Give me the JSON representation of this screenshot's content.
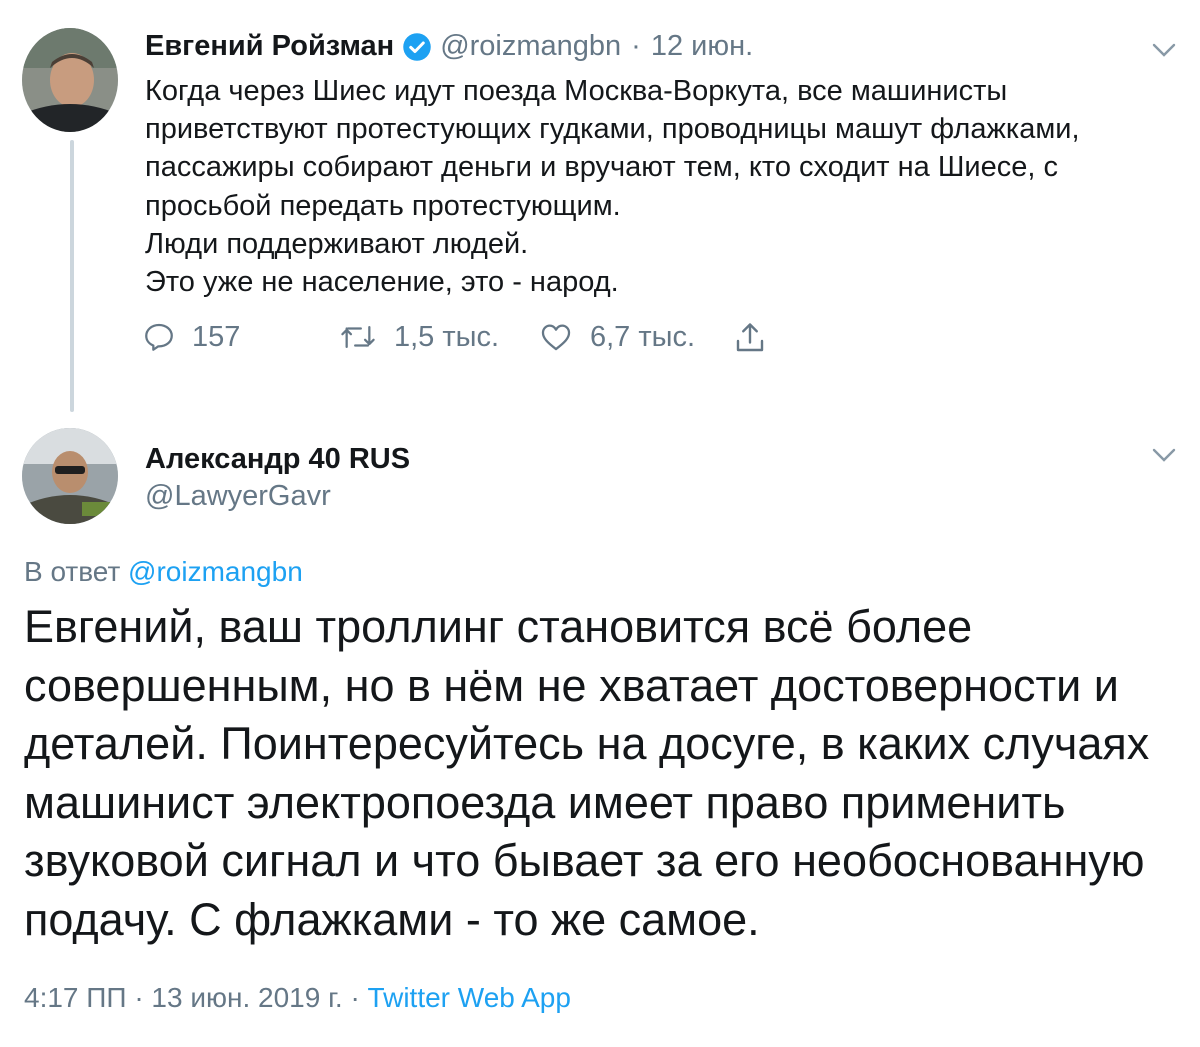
{
  "tweet1": {
    "author_name": "Евгений Ройзман",
    "handle": "@roizmangbn",
    "separator": "·",
    "date": "12 июн.",
    "lines": [
      "Когда через Шиес идут поезда Москва-Воркута, все машинисты",
      "приветствуют протестующих гудками, проводницы машут флажками,",
      "пассажиры собирают деньги и вручают тем, кто сходит на Шиесе, с",
      "просьбой передать протестующим.",
      "Люди поддерживают людей.",
      "Это уже не население, это - народ."
    ],
    "reply_count": "157",
    "retweet_count": "1,5 тыс.",
    "like_count": "6,7 тыс."
  },
  "tweet2": {
    "author_name": "Александр 40 RUS",
    "handle": "@LawyerGavr",
    "reply_prefix": "В ответ",
    "reply_handle": "@roizmangbn",
    "lines": [
      "Евгений, ваш троллинг становится всё более",
      "совершенным, но в нём не хватает достоверности и",
      "деталей. Поинтересуйтесь на досуге, в каких случаях",
      "машинист электропоезда имеет право применить",
      "звуковой сигнал и что бывает за его необоснованную",
      "подачу. С флажками - то же самое."
    ],
    "time": "4:17 ПП",
    "separator": "·",
    "date": "13 июн. 2019 г.",
    "source": "Twitter Web App"
  },
  "icons": {
    "verified": "verified-badge-icon",
    "chevron": "chevron-down-icon",
    "reply": "reply-icon",
    "retweet": "retweet-icon",
    "like": "heart-icon",
    "share": "share-icon"
  },
  "colors": {
    "link": "#1da1f2",
    "secondary_text": "#657786",
    "primary_text": "#14171a",
    "thread_line": "#ccd6dd"
  }
}
